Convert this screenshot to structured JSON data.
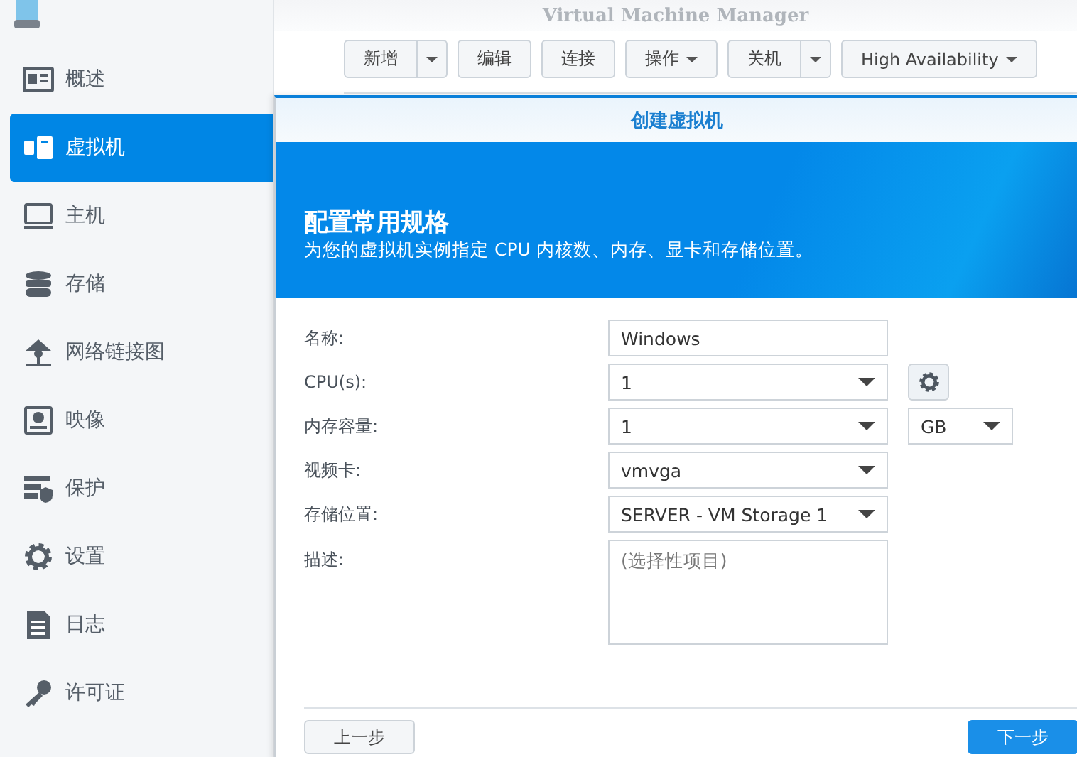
{
  "window": {
    "title": "Virtual Machine Manager"
  },
  "sidebar": {
    "items": [
      {
        "label": "概述",
        "selected": false
      },
      {
        "label": "虚拟机",
        "selected": true
      },
      {
        "label": "主机",
        "selected": false
      },
      {
        "label": "存储",
        "selected": false
      },
      {
        "label": "网络链接图",
        "selected": false
      },
      {
        "label": "映像",
        "selected": false
      },
      {
        "label": "保护",
        "selected": false
      },
      {
        "label": "设置",
        "selected": false
      },
      {
        "label": "日志",
        "selected": false
      },
      {
        "label": "许可证",
        "selected": false
      }
    ]
  },
  "toolbar": [
    {
      "label": "新增",
      "kind": "split"
    },
    {
      "label": "编辑",
      "kind": "plain"
    },
    {
      "label": "连接",
      "kind": "plain"
    },
    {
      "label": "操作",
      "kind": "dropdown"
    },
    {
      "label": "关机",
      "kind": "split"
    },
    {
      "label": "High Availability",
      "kind": "dropdown"
    }
  ],
  "dialog": {
    "title": "创建虚拟机",
    "heading": "配置常用规格",
    "subtitle": "为您的虚拟机实例指定 CPU 内核数、内存、显卡和存储位置。",
    "fields": [
      {
        "label": "名称:",
        "kind": "text",
        "value": "Windows"
      },
      {
        "label": "CPU(s):",
        "kind": "select",
        "value": "1",
        "extra": {
          "kind": "gear"
        }
      },
      {
        "label": "内存容量:",
        "kind": "select",
        "value": "1",
        "extra": {
          "kind": "select",
          "value": "GB"
        }
      },
      {
        "label": "视频卡:",
        "kind": "select",
        "value": "vmvga"
      },
      {
        "label": "存储位置:",
        "kind": "select",
        "value": "SERVER - VM Storage 1"
      },
      {
        "label": "描述:",
        "kind": "textarea",
        "placeholder": "(选择性项目)"
      }
    ],
    "back_button": "上一步",
    "next_button": "下一步"
  }
}
